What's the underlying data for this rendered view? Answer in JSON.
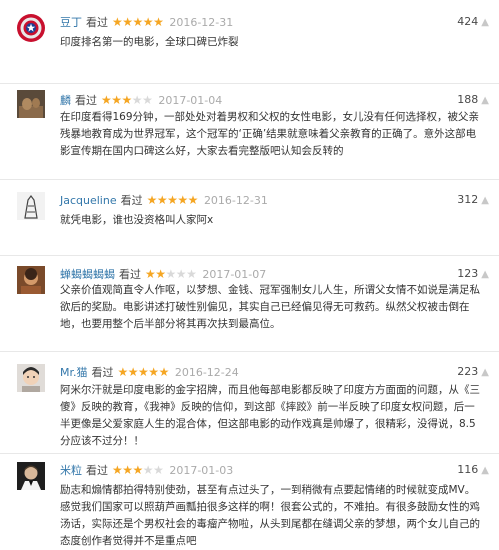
{
  "reviews": [
    {
      "username": "豆丁",
      "watched_label": "看过",
      "rating": 5,
      "max_rating": 5,
      "date": "2016-12-31",
      "votes": "424",
      "comment": "印度排名第一的电影，全球口碑已炸裂",
      "avatar": "captain-america-shield"
    },
    {
      "username": "麟",
      "watched_label": "看过",
      "rating": 3,
      "max_rating": 5,
      "date": "2017-01-04",
      "votes": "188",
      "comment": "在印度看得169分钟，一部处处对着男权和父权的女性电影，女儿没有任何选择权，被父亲残暴地教育成为世界冠军，这个冠军的‘正确’结果就意味着父亲教育的正确了。意外这部电影宣传期在国内口碑这么好，大家去看完整版吧认知会反转的",
      "avatar": "photo"
    },
    {
      "username": "Jacqueline",
      "watched_label": "看过",
      "rating": 5,
      "max_rating": 5,
      "date": "2016-12-31",
      "votes": "312",
      "comment": "就凭电影，谁也没资格叫人家阿x",
      "avatar": "sketch"
    },
    {
      "username": "蝉蝎蝎蝎蝎",
      "watched_label": "看过",
      "rating": 2,
      "max_rating": 5,
      "date": "2017-01-07",
      "votes": "123",
      "comment": "父亲价值观简直令人作呕，以梦想、金钱、冠军强制女儿人生，所谓父女情不如说是满足私欲后的奖励。电影讲述打破性别偏见，其实自己已经偏见得无可救药。纵然父权被击倒在地，也要用整个后半部分将其再次扶到最高位。",
      "avatar": "photo-warm"
    },
    {
      "username": "Mr.猫",
      "watched_label": "看过",
      "rating": 5,
      "max_rating": 5,
      "date": "2016-12-24",
      "votes": "223",
      "comment": "阿米尔汗就是印度电影的金字招牌，而且他每部电影都反映了印度方方面面的问题，从《三傻》反映的教育，《我神》反映的信仰，到这部《摔跤》前一半反映了印度女权问题，后一半更像是父爱家庭人生的混合体，但这部电影的动作戏真是帅爆了，很精彩，没得说，8.5分应该不过分！！",
      "avatar": "face"
    },
    {
      "username": "米粒",
      "watched_label": "看过",
      "rating": 3,
      "max_rating": 5,
      "date": "2017-01-03",
      "votes": "116",
      "comment": "励志和煽情都拍得特别使劲，甚至有点过头了，一到稍微有点要起情绪的时候就变成MV。感觉我们国家可以照葫芦画瓢拍很多这样的啊！很套公式的，不难拍。有很多鼓励女性的鸡汤话，实际还是个男权社会的毒瘤产物啦，从头到尾都在缝调父亲的梦想，两个女儿自己的态度创作者觉得并不是重点吧",
      "avatar": "face-dark"
    }
  ]
}
